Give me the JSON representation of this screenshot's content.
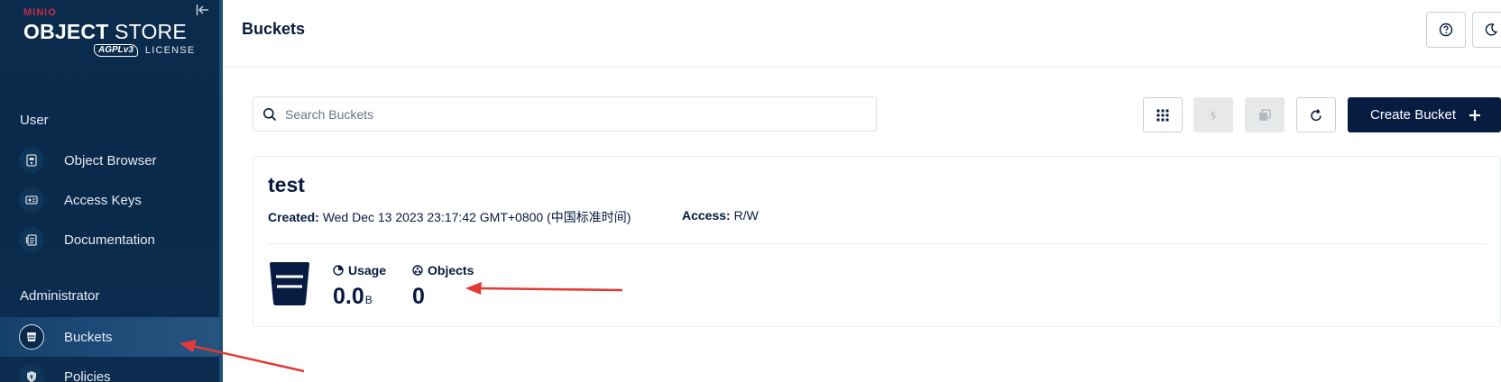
{
  "sidebar": {
    "brand": "MINIO",
    "title_bold": "OBJECT",
    "title_light": " STORE",
    "license_mark": "AGPLv3",
    "license_text": "LICENSE",
    "sections": [
      {
        "title": "User",
        "items": [
          {
            "label": "Object Browser",
            "icon": "object-browser-icon"
          },
          {
            "label": "Access Keys",
            "icon": "access-keys-icon"
          },
          {
            "label": "Documentation",
            "icon": "documentation-icon"
          }
        ]
      },
      {
        "title": "Administrator",
        "items": [
          {
            "label": "Buckets",
            "icon": "bucket-icon",
            "active": true
          },
          {
            "label": "Policies",
            "icon": "policies-icon"
          }
        ]
      }
    ]
  },
  "header": {
    "title": "Buckets"
  },
  "toolbar": {
    "search_placeholder": "Search Buckets",
    "create_label": "Create Bucket"
  },
  "buckets": [
    {
      "name": "test",
      "created_label": "Created:",
      "created_value": "Wed Dec 13 2023 23:17:42 GMT+0800 (中国标准时间)",
      "access_label": "Access:",
      "access_value": "R/W",
      "usage_label": "Usage",
      "usage_value": "0.0",
      "usage_unit": "B",
      "objects_label": "Objects",
      "objects_value": "0"
    }
  ],
  "colors": {
    "sidebar_bg": "#0b2b4d",
    "primary": "#081c42",
    "brand_red": "#c72c48",
    "annotation_red": "#e53935"
  }
}
